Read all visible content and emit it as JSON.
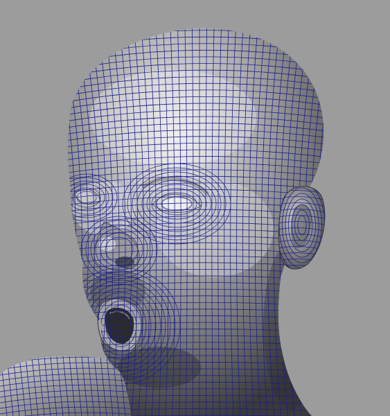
{
  "viewport": {
    "background": "#9c9c9c",
    "wire_color": "#1c1f8c",
    "surface_light": "#e6e6e6",
    "surface_mid": "#8d8d8d",
    "surface_dark": "#3c3c3c",
    "object": "head-model-wireframe-on-shaded"
  }
}
